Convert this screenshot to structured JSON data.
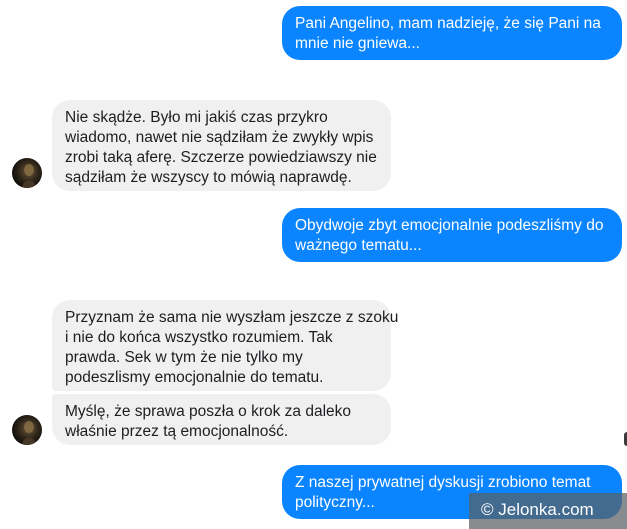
{
  "messages": [
    {
      "side": "outgoing",
      "lines": [
        "Pani Angelino, mam nadzieję, że się Pani na",
        "mnie nie gniewa..."
      ]
    },
    {
      "side": "incoming",
      "lines": [
        "Nie skądże. Było mi jakiś czas przykro",
        "wiadomo, nawet nie sądziłam że zwykły wpis",
        "zrobi taką aferę. Szczerze powiedziawszy nie",
        "sądziłam że wszyscy to mówią naprawdę."
      ]
    },
    {
      "side": "outgoing",
      "lines": [
        "Obydwoje zbyt emocjonalnie podeszliśmy do",
        "ważnego tematu..."
      ]
    },
    {
      "side": "incoming",
      "lines": [
        "Przyznam że sama nie wyszłam jeszcze z szoku",
        "i nie do końca wszystko rozumiem. Tak",
        "prawda. Sek w tym że nie tylko my",
        "podeszlismy emocjonalnie do tematu."
      ]
    },
    {
      "side": "incoming",
      "lines": [
        "Myślę, że sprawa poszła o krok za daleko",
        "właśnie przez tą emocjonalność."
      ]
    },
    {
      "side": "outgoing",
      "lines": [
        "Z naszej prywatnej dyskusji zrobiono temat",
        "polityczny..."
      ]
    }
  ],
  "colors": {
    "outgoing_bubble": "#0a84ff",
    "incoming_bubble": "#f0f0f0",
    "outgoing_text": "#ffffff",
    "incoming_text": "#1c1e21"
  },
  "watermark": {
    "text": "© Jelonka.com"
  }
}
